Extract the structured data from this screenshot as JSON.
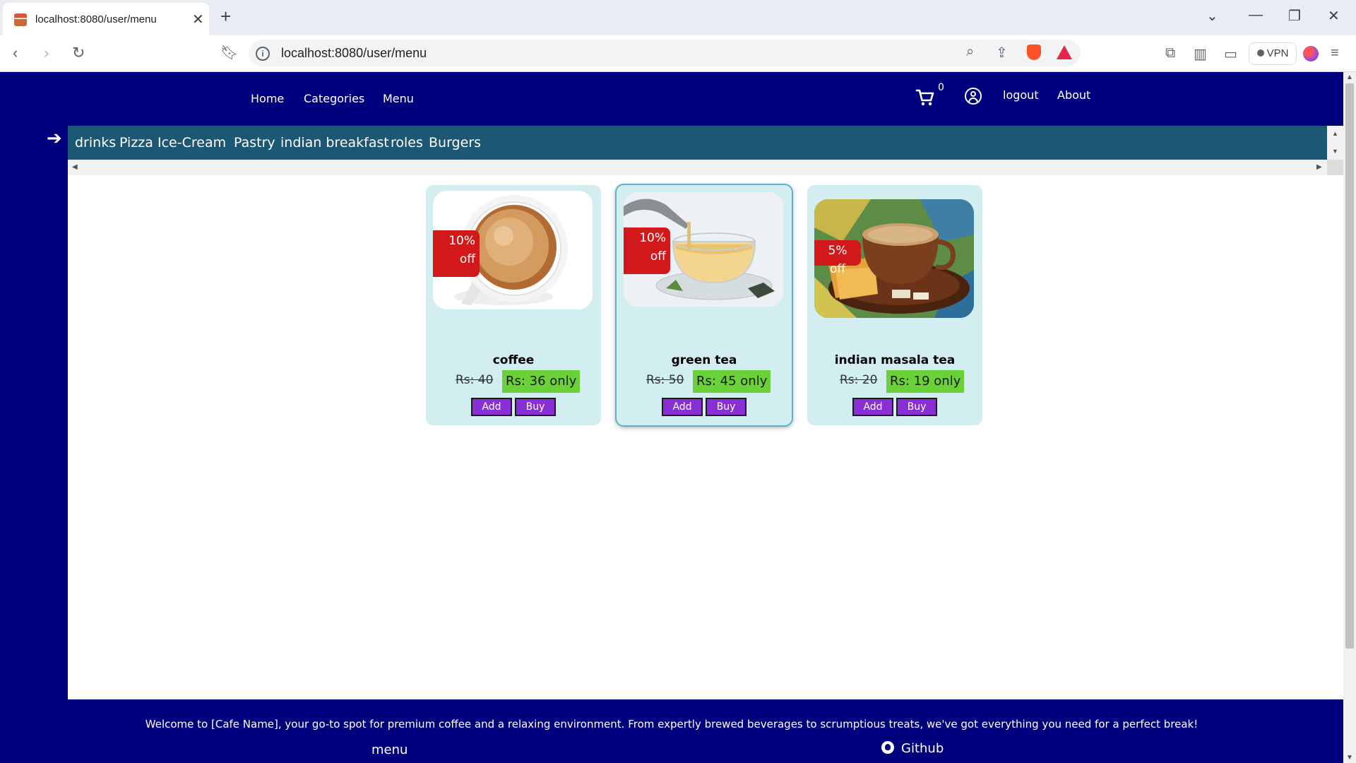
{
  "browser": {
    "tab_title": "localhost:8080/user/menu",
    "url": "localhost:8080/user/menu",
    "vpn_label": "VPN"
  },
  "nav": {
    "home": "Home",
    "categories": "Categories",
    "menu": "Menu",
    "cart_count": "0",
    "logout": "logout",
    "about": "About"
  },
  "categories": [
    "drinks",
    "Pizza",
    "Ice-Cream",
    "Pastry",
    "indian breakfast",
    "roles",
    "Burgers"
  ],
  "products": [
    {
      "name": "coffee",
      "discount_line1": "10%",
      "discount_line2": "off",
      "old_price": "Rs: 40",
      "new_price": "Rs: 36 only",
      "add_label": "Add",
      "buy_label": "Buy"
    },
    {
      "name": "green tea",
      "discount_line1": "10%",
      "discount_line2": "off",
      "old_price": "Rs: 50",
      "new_price": "Rs: 45 only",
      "add_label": "Add",
      "buy_label": "Buy"
    },
    {
      "name": "indian masala tea",
      "discount_line1": "5% off",
      "discount_line2": "",
      "old_price": "Rs: 20",
      "new_price": "Rs: 19 only",
      "add_label": "Add",
      "buy_label": "Buy"
    }
  ],
  "footer": {
    "text": "Welcome to [Cafe Name], your go-to spot for premium coffee and a relaxing environment. From expertly brewed beverages to scrumptious treats, we've got everything you need for a perfect break!",
    "menu_link": "menu",
    "github_link": "Github"
  },
  "colors": {
    "page_bg": "#00007f",
    "category_bar": "#1c5774",
    "card_bg": "#d2eef0",
    "discount": "#d1191b",
    "price_tag": "#6bd138",
    "button": "#8a2ed6"
  }
}
